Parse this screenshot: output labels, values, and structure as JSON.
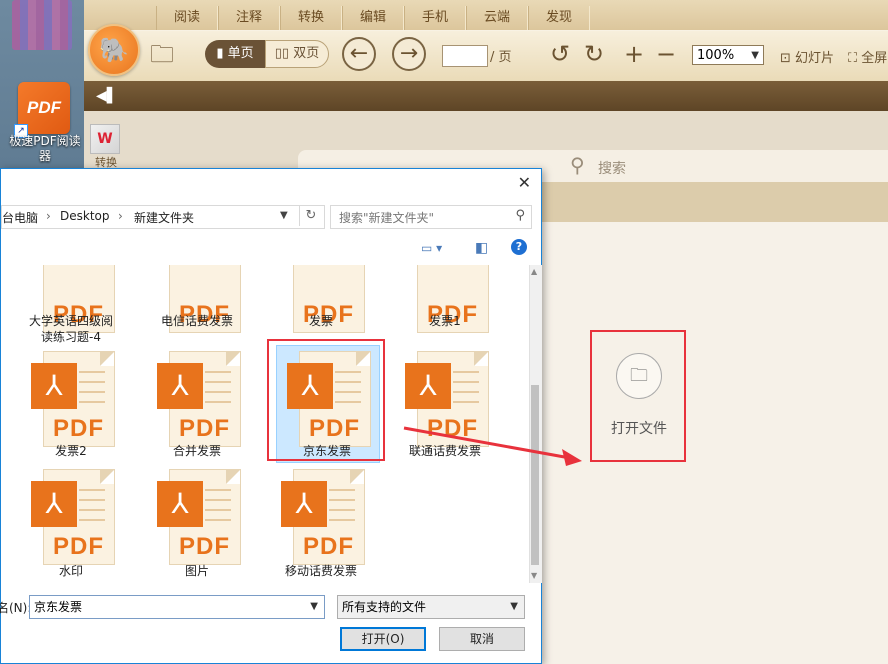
{
  "desktop": {
    "shortcut_label_line1": "极速PDF阅读",
    "shortcut_label_line2": "器",
    "shortcut_icon_text": "PDF"
  },
  "app": {
    "menu_tabs": [
      "阅读",
      "注释",
      "转换",
      "编辑",
      "手机",
      "云端",
      "发现"
    ],
    "view_single": "单页",
    "view_double": "双页",
    "page_suffix": "/ 页",
    "zoom_value": "100%",
    "slideshow": "幻灯片",
    "fullscreen": "全屏",
    "side_tool_label": "转换",
    "search_placeholder": "搜索",
    "open_file_label": "打开文件"
  },
  "dialog": {
    "breadcrumb": [
      "台电脑",
      "Desktop",
      "新建文件夹"
    ],
    "search_placeholder": "搜索\"新建文件夹\"",
    "files": [
      {
        "name": "大学英语四级阅读练习题-4",
        "line1": "大学英语四级阅",
        "line2": "读练习题-4"
      },
      {
        "name": "电信话费发票",
        "line1": "电信话费发票",
        "line2": ""
      },
      {
        "name": "发票",
        "line1": "发票",
        "line2": ""
      },
      {
        "name": "发票1",
        "line1": "发票1",
        "line2": ""
      },
      {
        "name": "发票2",
        "line1": "发票2",
        "line2": ""
      },
      {
        "name": "合并发票",
        "line1": "合并发票",
        "line2": ""
      },
      {
        "name": "京东发票",
        "line1": "京东发票",
        "line2": ""
      },
      {
        "name": "联通话费发票",
        "line1": "联通话费发票",
        "line2": ""
      },
      {
        "name": "水印",
        "line1": "水印",
        "line2": ""
      },
      {
        "name": "图片",
        "line1": "图片",
        "line2": ""
      },
      {
        "name": "移动话费发票",
        "line1": "移动话费发票",
        "line2": ""
      }
    ],
    "pdf_mark": "PDF",
    "filename_label": "名(N):",
    "filename_value": "京东发票",
    "filetype_value": "所有支持的文件",
    "open_button": "打开(O)",
    "cancel_button": "取消"
  },
  "colors": {
    "accent_red": "#e8323c",
    "pdf_orange": "#e8731c",
    "app_brown": "#6a5236",
    "selection_blue": "#cce8ff"
  }
}
